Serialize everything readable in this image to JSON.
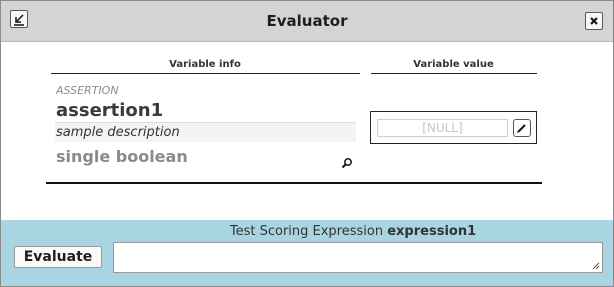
{
  "window": {
    "title": "Evaluator",
    "collapse_icon": "collapse-arrow-icon",
    "close_icon": "close-icon"
  },
  "columns": {
    "info_header": "Variable info",
    "value_header": "Variable value"
  },
  "variable": {
    "category": "ASSERTION",
    "name": "assertion1",
    "description": "sample description",
    "type": "single boolean",
    "value": "[NULL]",
    "zoom_icon": "magnifier-icon",
    "edit_icon": "pencil-icon"
  },
  "expression": {
    "label_prefix": "Test Scoring Expression",
    "label_name": "expression1",
    "evaluate_label": "Evaluate",
    "input_value": ""
  },
  "colors": {
    "titlebar": "#d4d4d4",
    "bottom_panel": "#a9d5e3"
  }
}
